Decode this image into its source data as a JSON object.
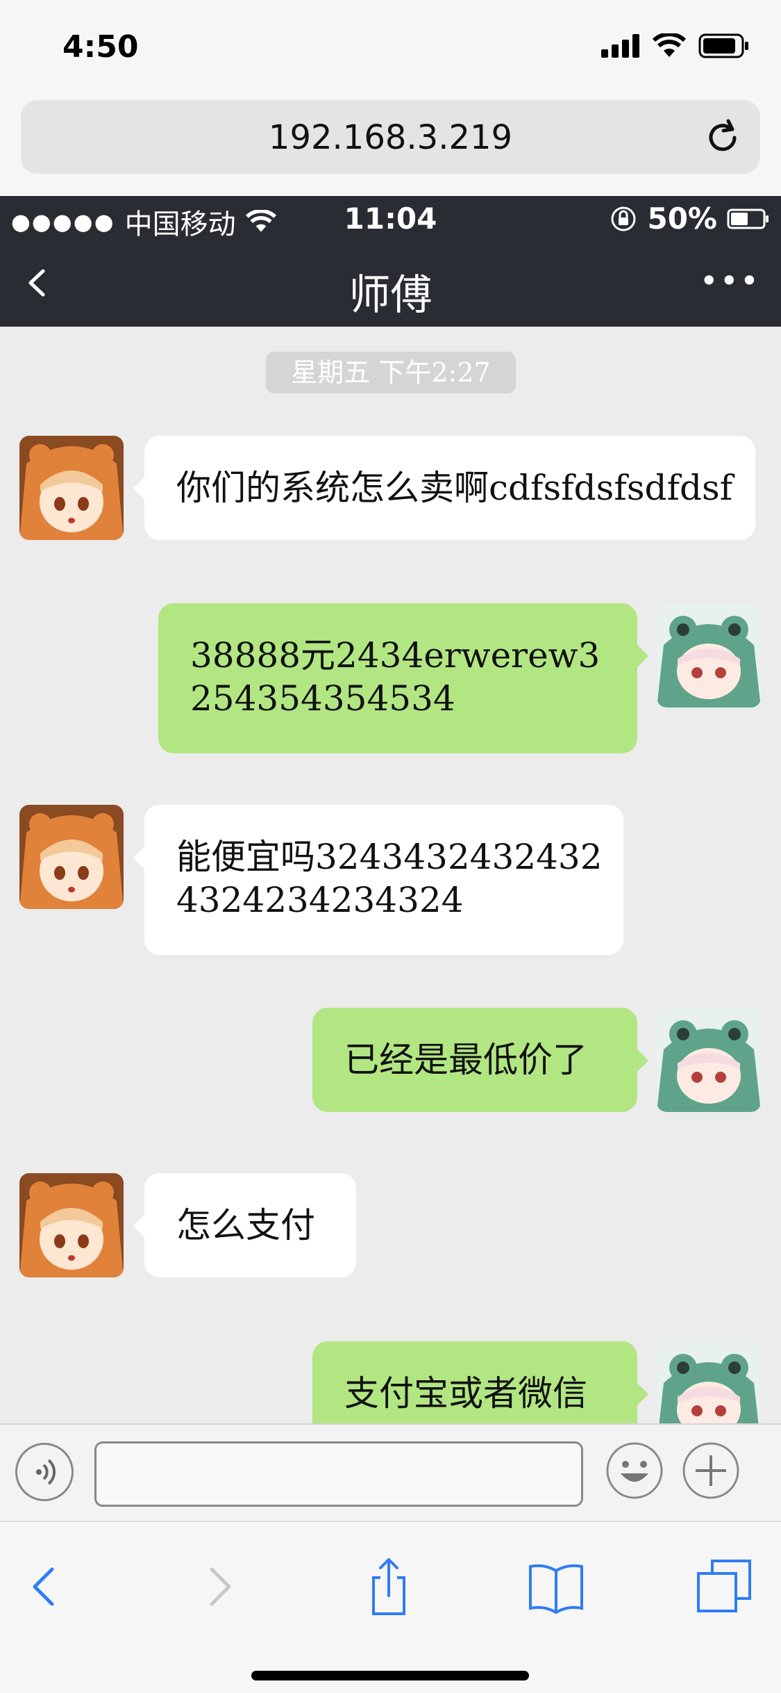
{
  "ios_status": {
    "time": "4:50"
  },
  "safari": {
    "url": "192.168.3.219"
  },
  "inner_status": {
    "carrier": "中国移动",
    "time": "11:04",
    "battery": "50%"
  },
  "chat_header": {
    "title": "师傅"
  },
  "chat": {
    "timestamp": "星期五 下午2:27",
    "messages": [
      {
        "side": "left",
        "text": "你们的系统怎么卖啊cdfsfdsfsdfdsf"
      },
      {
        "side": "right",
        "text": "38888元2434erwerew3254354354534"
      },
      {
        "side": "left",
        "text": "能便宜吗32434324324324324234234324"
      },
      {
        "side": "right",
        "text": "已经是最低价了"
      },
      {
        "side": "left",
        "text": "怎么支付"
      },
      {
        "side": "right",
        "text": "支付宝或者微信"
      }
    ]
  },
  "input_bar": {
    "text_value": ""
  },
  "colors": {
    "header_bg": "#2a2c33",
    "chat_bg": "#ececec",
    "bubble_self": "#b2e682",
    "bubble_other": "#ffffff",
    "safari_blue": "#2f7cf6"
  }
}
